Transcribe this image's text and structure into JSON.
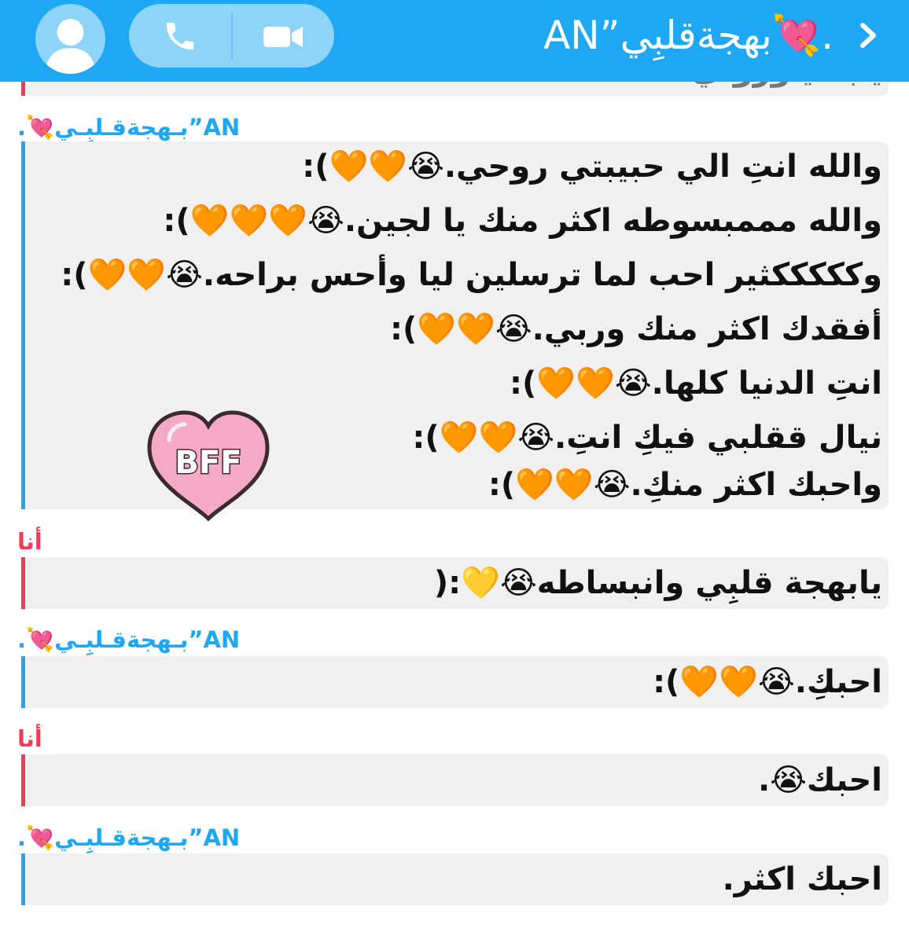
{
  "header": {
    "title": ".💘بهجةقلبِي”AN",
    "icons": [
      "avatar-icon",
      "phone-icon",
      "video-camera-icon",
      "chevron-right-icon"
    ],
    "color": "#1ea7f2"
  },
  "colors": {
    "friend": "#1ea7f2",
    "me": "#f23c57",
    "bubble": "#f0f0f0"
  },
  "top_fragment": {
    "text": "يابـ ـيـوروـي"
  },
  "message1": {
    "sender": ".💘بـهجةقـلبِـي”AN",
    "lines": [
      "والله انتِ الي حبيبتي روحي.😭🧡🧡):",
      "والله مممبسوطه اكثر منك يا لجين.😭🧡🧡🧡):",
      "وكككككثير احب لما ترسلين ليا وأحس براحه.😭🧡🧡):",
      "أفقدك اكثر منك وربي.😭🧡🧡):",
      "انتِ الدنيا كلها.😭🧡🧡):",
      "نيال ققلبي فيكِ انتِ.😭🧡🧡):",
      "واحبك اكثر منكِ.😭🧡🧡):"
    ],
    "sticker_text": "BFF"
  },
  "message2": {
    "sender": "أنا",
    "text": "يابهجة قلبِي وانبساطه😭💛:("
  },
  "message3": {
    "sender": ".💘بـهجةقـلبِـي”AN",
    "text": "احبكِ.😭🧡🧡):"
  },
  "message4": {
    "sender": "أنا",
    "text": "احبك😭."
  },
  "message5": {
    "sender": ".💘بـهجةقـلبِـي”AN",
    "text": "احبك اكثر."
  }
}
